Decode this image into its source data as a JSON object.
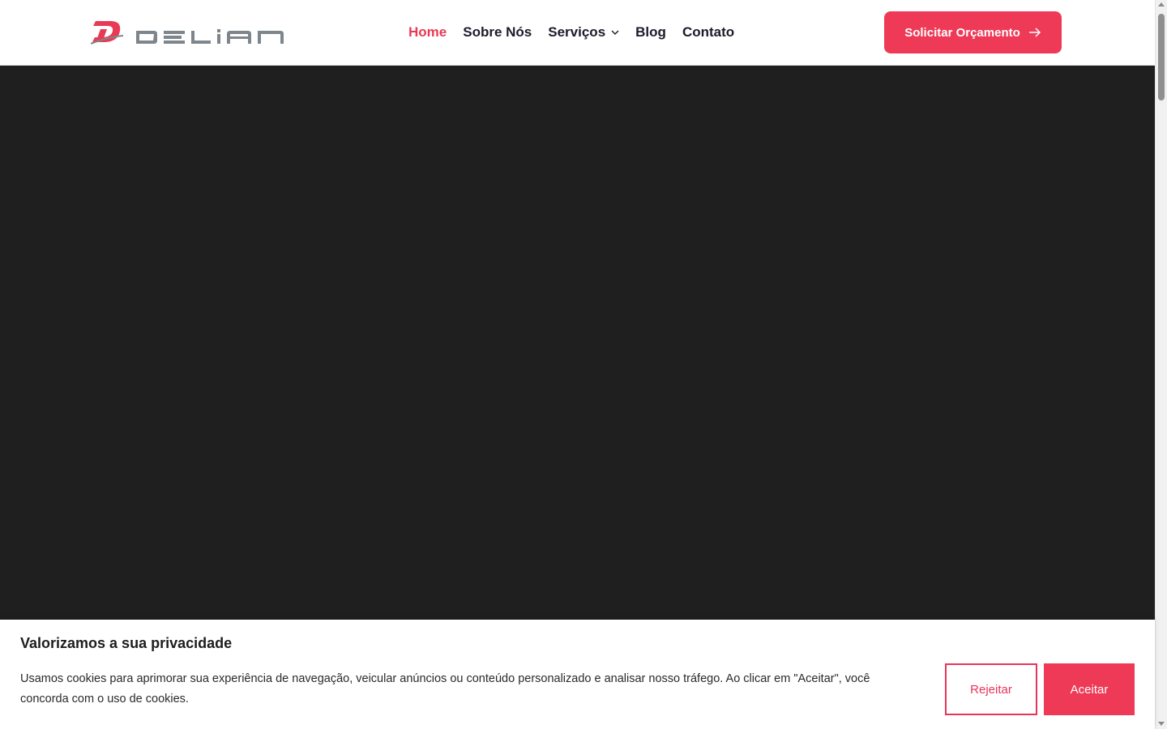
{
  "header": {
    "logo_icon": "delian-logo",
    "nav": [
      {
        "label": "Home",
        "active": true
      },
      {
        "label": "Sobre Nós",
        "active": false
      },
      {
        "label": "Serviços",
        "active": false,
        "has_dropdown": true
      },
      {
        "label": "Blog",
        "active": false
      },
      {
        "label": "Contato",
        "active": false
      }
    ],
    "cta_label": "Solicitar Orçamento",
    "cta_icon": "arrow-right-icon"
  },
  "cookie_banner": {
    "title": "Valorizamos a sua privacidade",
    "text": "Usamos cookies para aprimorar sua experiência de navegação, veicular anúncios ou conteúdo personalizado e analisar nosso tráfego. Ao clicar em \"Aceitar\", você concorda com o uso de cookies.",
    "reject_label": "Rejeitar",
    "accept_label": "Aceitar"
  },
  "colors": {
    "accent": "#ee3a56",
    "nav_text": "#1b1b2b",
    "hero_bg": "#1f1f1f",
    "logo_gray": "#7d868c"
  }
}
